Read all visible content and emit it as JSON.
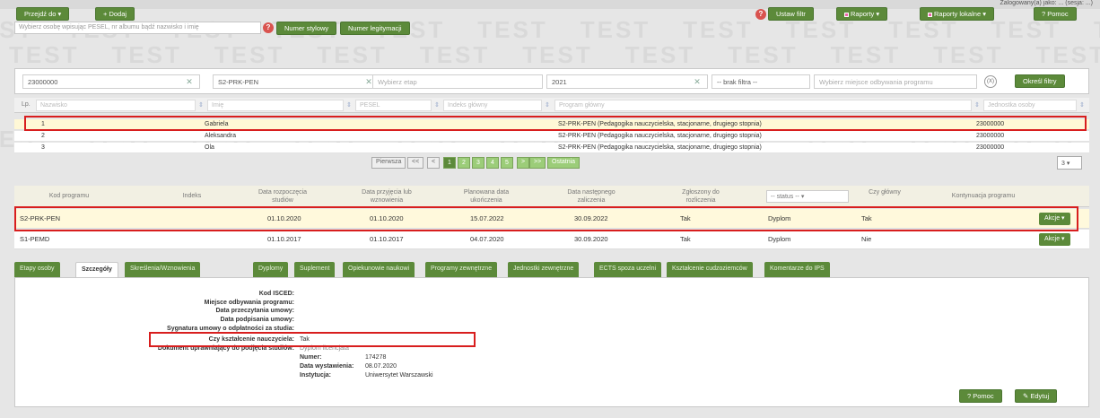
{
  "watermark": "TEST",
  "header": {
    "user": "Zalogowany(a) jako: ... (sesja: ...)"
  },
  "toolbar": {
    "goto_label": "Przejdź do ▾",
    "add_label": "+ Dodaj",
    "filter_label": "Ustaw filtr",
    "reports_label": "Raporty ▾",
    "local_reports_label": "Raporty lokalne ▾",
    "help_label": "? Pomoc"
  },
  "search": {
    "placeholder": "Wybierz osobę wpisując PESEL, nr albumu bądź nazwisko i imię",
    "btn_styl": "Numer stylowy",
    "btn_legit": "Numer legitymacji"
  },
  "filters": {
    "unit": "23000000",
    "program": "S2-PRK-PEN",
    "stage_placeholder": "Wybierz etap",
    "year": "2021",
    "filter_value": "-- brak filtra --",
    "place_placeholder": "Wybierz miejsce odbywania programu",
    "apply_label": "Określ filtry",
    "clear_label": "(X)"
  },
  "person_table": {
    "columns": [
      "Lp.",
      "Nazwisko",
      "Imię",
      "PESEL",
      "Indeks główny",
      "Program główny",
      "Jednostka osoby"
    ],
    "rows": [
      {
        "lp": "1",
        "nazwisko": "",
        "imie": "Gabriela",
        "program": "S2-PRK-PEN (Pedagogika nauczycielska, stacjonarne, drugiego stopnia)",
        "jednostka": "23000000"
      },
      {
        "lp": "2",
        "nazwisko": "",
        "imie": "Aleksandra",
        "program": "S2-PRK-PEN (Pedagogika nauczycielska, stacjonarne, drugiego stopnia)",
        "jednostka": "23000000"
      },
      {
        "lp": "3",
        "nazwisko": "",
        "imie": "Ola",
        "program": "S2-PRK-PEN (Pedagogika nauczycielska, stacjonarne, drugiego stopnia)",
        "jednostka": "23000000"
      }
    ]
  },
  "pager": {
    "first": "Pierwsza",
    "prev2": "<<",
    "prev": "<",
    "pages": [
      "1",
      "2",
      "3",
      "4",
      "5"
    ],
    "next": ">",
    "next2": ">>",
    "last": "Ostatnia",
    "per_page": "3 ▾"
  },
  "program_table": {
    "columns": [
      "Kod programu",
      "Indeks",
      "Data rozpoczęcia studiów",
      "Data przyjęcia lub wznowienia",
      "Planowana data ukończenia",
      "Data następnego zaliczenia",
      "Zgłoszony do rozliczenia",
      "-- status -- ▾",
      "Czy główny",
      "Kontynuacja programu"
    ],
    "rows": [
      {
        "kod": "S2-PRK-PEN",
        "indeks": "",
        "start": "01.10.2020",
        "przyjecie": "01.10.2020",
        "planowana": "15.07.2022",
        "nastepne": "30.09.2022",
        "zgloszony": "Tak",
        "status": "Dyplom",
        "glowny": "Tak",
        "kontynuacja": "",
        "action": "Akcje ▾"
      },
      {
        "kod": "S1-PEMD",
        "indeks": "",
        "start": "01.10.2017",
        "przyjecie": "01.10.2017",
        "planowana": "04.07.2020",
        "nastepne": "30.09.2020",
        "zgloszony": "Tak",
        "status": "Dyplom",
        "glowny": "Nie",
        "kontynuacja": "",
        "action": "Akcje ▾"
      }
    ]
  },
  "tabs": [
    "Etapy osoby",
    "Szczegóły",
    "Skreślenia/Wznowienia",
    "Dyplomy",
    "Suplement",
    "Opiekunowie naukowi",
    "Programy zewnętrzne",
    "Jednostki zewnętrzne",
    "ECTS spoza uczelni",
    "Kształcenie cudzoziemców",
    "Komentarze do IPS"
  ],
  "details": {
    "labels": {
      "isced": "Kod ISCED:",
      "miejsce": "Miejsce odbywania programu:",
      "przeczytania": "Data przeczytania umowy:",
      "podpisania": "Data podpisania umowy:",
      "sygnatura": "Sygnatura umowy o odpłatności za studia:",
      "nauczyciel": "Czy kształcenie nauczyciela:",
      "dokument": "Dokument uprawniający do podjęcia studiów:",
      "numer": "Numer:",
      "data_wyst": "Data wystawienia:",
      "instytucja": "Instytucja:"
    },
    "values": {
      "nauczyciel": "Tak",
      "dokument": "Dyplom licencjata",
      "numer": "174278",
      "data_wyst": "08.07.2020",
      "instytucja": "Uniwersytet Warszawski"
    },
    "help_label": "? Pomoc",
    "edit_label": "✎ Edytuj"
  }
}
